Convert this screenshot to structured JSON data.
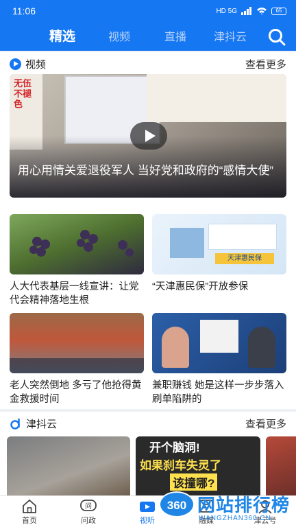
{
  "status_bar": {
    "time": "11:06",
    "signal": "HD 5G",
    "battery": "65"
  },
  "tabs": [
    {
      "label": "精选",
      "active": true
    },
    {
      "label": "视频",
      "active": false
    },
    {
      "label": "直播",
      "active": false
    },
    {
      "label": "津抖云",
      "active": false
    }
  ],
  "video_section": {
    "title": "视频",
    "more": "查看更多",
    "hero": {
      "title": "用心用情关爱退役军人 当好党和政府的“感情大使”",
      "sign_text": "无伍不褪色"
    },
    "items": [
      {
        "caption": "人大代表基层一线宣讲：让党代会精神落地生根"
      },
      {
        "caption": "“天津惠民保”开放参保",
        "thumb_text": "天津惠民保"
      },
      {
        "caption": "老人突然倒地 多亏了他抢得黄金救援时间"
      },
      {
        "caption": "兼职赚钱 她是这样一步步落入刷单陷阱的"
      }
    ]
  },
  "jindouyun_section": {
    "title": "津抖云",
    "more": "查看更多",
    "card_text_line1": "开个脑洞!",
    "card_text_line2": "如果刹车失灵了",
    "card_text_line3": "该撞哪?"
  },
  "bottom_nav": [
    {
      "label": "首页",
      "icon": "home-icon"
    },
    {
      "label": "问政",
      "icon": "question-icon"
    },
    {
      "label": "视听",
      "icon": "tv-icon",
      "active": true
    },
    {
      "label": "融媒",
      "icon": "media-icon"
    },
    {
      "label": "津云号",
      "icon": "profile-icon"
    }
  ],
  "watermark": {
    "badge": "360",
    "text": "网站排行榜",
    "sub": "WANGZHAN360.CN"
  },
  "colors": {
    "brand": "#1677f2",
    "tab_inactive": "#b9d4fb"
  }
}
